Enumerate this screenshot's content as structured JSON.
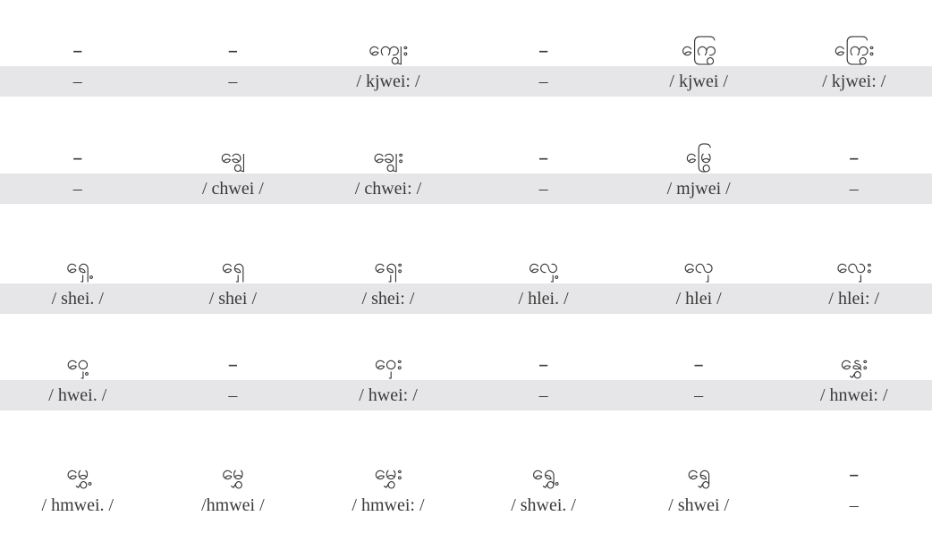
{
  "rows": [
    {
      "burmese": [
        "–",
        "–",
        "ကျွေး",
        "–",
        "ကြွေ",
        "ကြွေး"
      ],
      "roman": [
        "–",
        "–",
        "/ kjwei: /",
        "–",
        "/ kjwei /",
        "/ kjwei: /"
      ]
    },
    {
      "burmese": [
        "–",
        "ချွေ",
        "ချွေး",
        "–",
        "မြွေ",
        "–"
      ],
      "roman": [
        "–",
        "/ chwei /",
        "/ chwei: /",
        "–",
        "/ mjwei /",
        "–"
      ]
    },
    {
      "burmese": [
        "ရှေ့",
        "ရှေ",
        "ရှေး",
        "လှေ့",
        "လှေ",
        "လှေး"
      ],
      "roman": [
        "/ shei. /",
        "/ shei /",
        "/ shei: /",
        "/ hlei. /",
        "/ hlei /",
        "/ hlei: /"
      ]
    },
    {
      "burmese": [
        "ဝှေ့",
        "–",
        "ဝှေး",
        "–",
        "–",
        "နွှေး"
      ],
      "roman": [
        "/ hwei. /",
        "–",
        "/ hwei: /",
        "–",
        "–",
        "/ hnwei: /"
      ]
    },
    {
      "burmese": [
        "မွှေ့",
        "မွှေ",
        "မွှေး",
        "ရွှေ့",
        "ရွှေ",
        "–"
      ],
      "roman": [
        "/ hmwei. /",
        "/hmwei /",
        "/ hmwei: /",
        "/ shwei. /",
        "/ shwei /",
        "–"
      ]
    }
  ]
}
